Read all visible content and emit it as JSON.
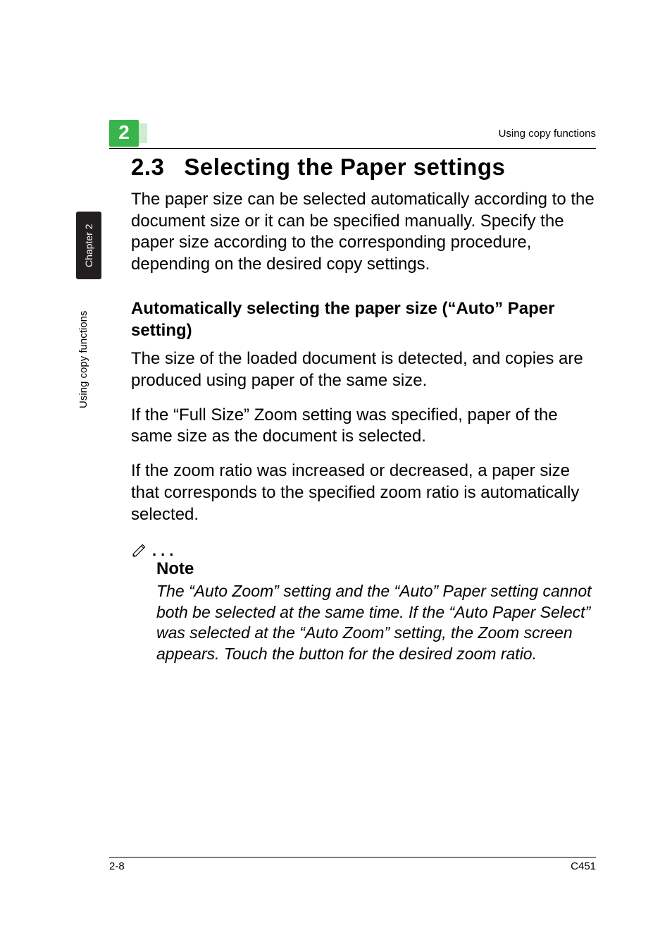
{
  "header": {
    "chapter_number": "2",
    "running_head": "Using copy functions"
  },
  "side_tab": {
    "label": "Chapter 2"
  },
  "side_label": {
    "text": "Using copy functions"
  },
  "section": {
    "number": "2.3",
    "title": "Selecting the Paper settings",
    "intro": "The paper size can be selected automatically according to the document size or it can be specified manually. Specify the paper size according to the corresponding procedure, depending on the desired copy settings."
  },
  "subsection": {
    "heading": "Automatically selecting the paper size (“Auto” Paper setting)",
    "p1": "The size of the loaded document is detected, and copies are produced using paper of the same size.",
    "p2": "If the “Full Size” Zoom setting was specified, paper of the same size as the document is selected.",
    "p3": "If the zoom ratio was increased or decreased, a paper size that corresponds to the specified zoom ratio is automatically selected."
  },
  "note": {
    "dots": "...",
    "title": "Note",
    "body": "The “Auto Zoom” setting and the “Auto” Paper setting cannot both be selected at the same time. If the “Auto Paper Select” was selected at the “Auto Zoom” setting, the Zoom screen appears. Touch the button for the desired zoom ratio."
  },
  "footer": {
    "left": "2-8",
    "right": "C451"
  }
}
